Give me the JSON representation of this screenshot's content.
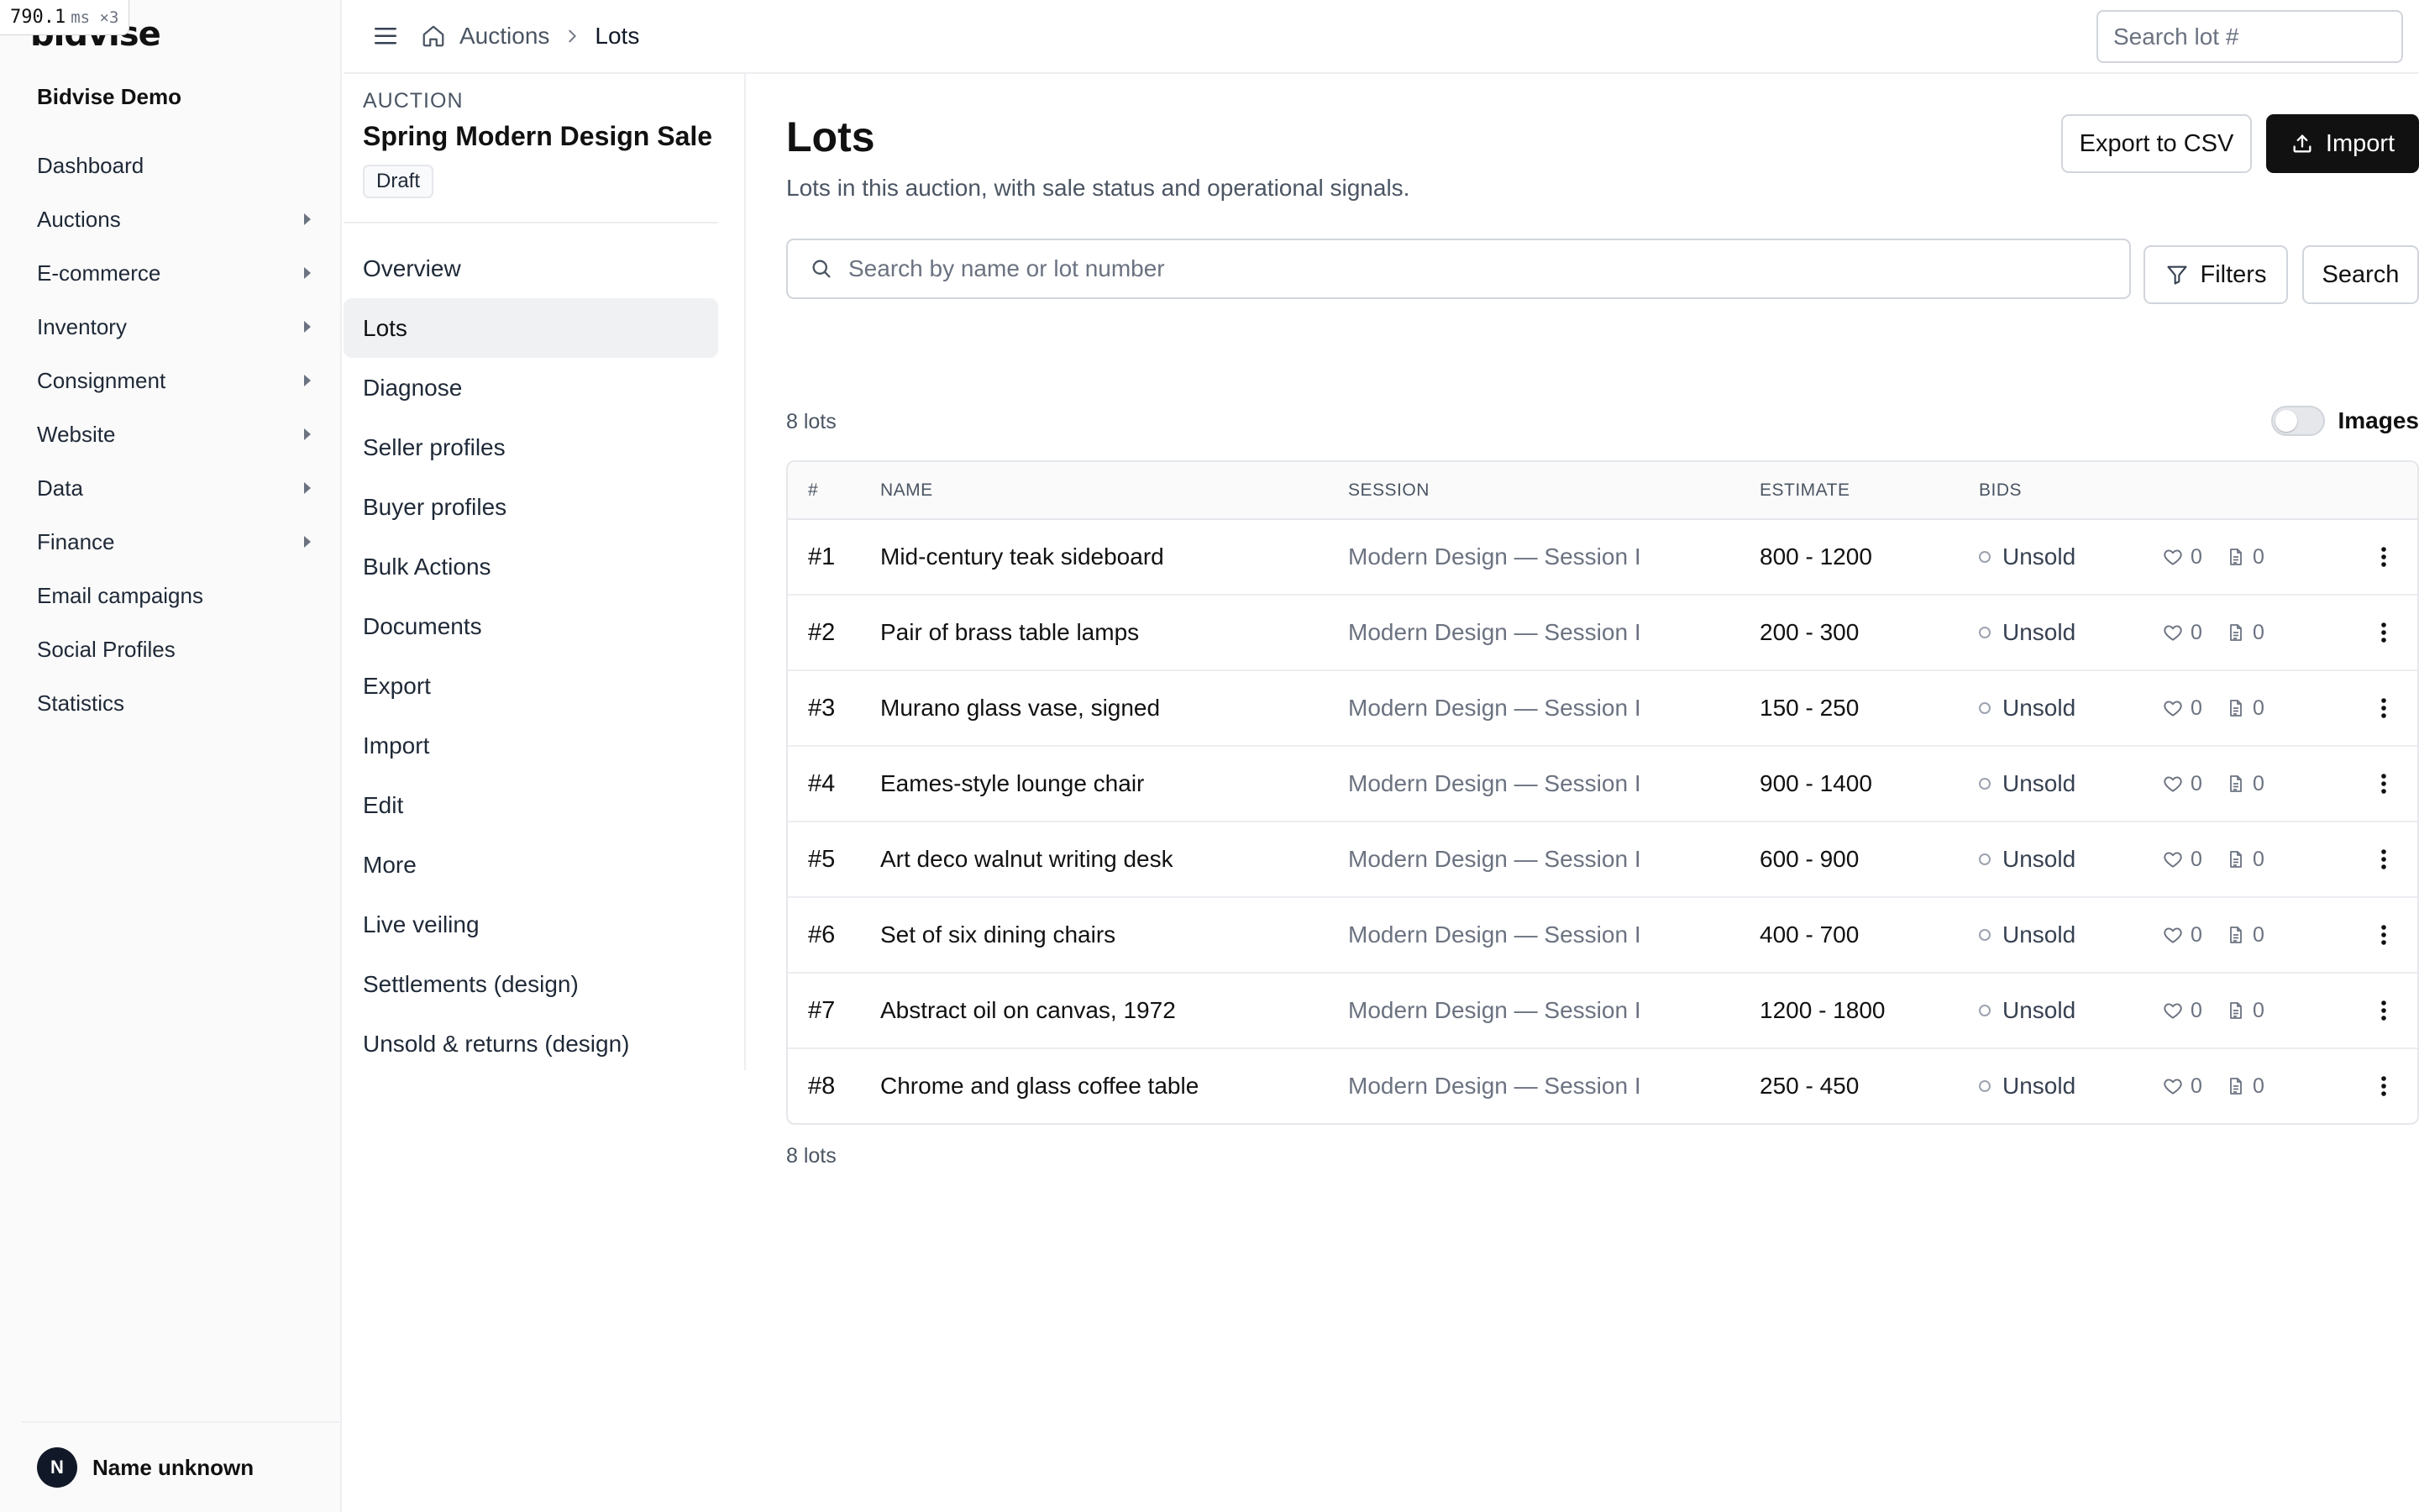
{
  "perf": {
    "value": "790.1",
    "unit": "ms ×3"
  },
  "brand": {
    "logo_text": "bidvise",
    "org_name": "Bidvise Demo"
  },
  "sidebar": {
    "items": [
      {
        "label": "Dashboard",
        "expandable": false
      },
      {
        "label": "Auctions",
        "expandable": true
      },
      {
        "label": "E-commerce",
        "expandable": true
      },
      {
        "label": "Inventory",
        "expandable": true
      },
      {
        "label": "Consignment",
        "expandable": true
      },
      {
        "label": "Website",
        "expandable": true
      },
      {
        "label": "Data",
        "expandable": true
      },
      {
        "label": "Finance",
        "expandable": true
      },
      {
        "label": "Email campaigns",
        "expandable": false
      },
      {
        "label": "Social Profiles",
        "expandable": false
      },
      {
        "label": "Statistics",
        "expandable": false
      }
    ],
    "user": {
      "initial": "N",
      "name": "Name unknown"
    }
  },
  "topbar": {
    "breadcrumb": [
      {
        "label": "Auctions"
      },
      {
        "label": "Lots"
      }
    ],
    "search_placeholder": "Search lot #"
  },
  "auction": {
    "kicker": "AUCTION",
    "title": "Spring Modern Design Sale",
    "status": "Draft",
    "nav": [
      {
        "label": "Overview",
        "active": false
      },
      {
        "label": "Lots",
        "active": true
      },
      {
        "label": "Diagnose",
        "active": false
      },
      {
        "label": "Seller profiles",
        "active": false
      },
      {
        "label": "Buyer profiles",
        "active": false
      },
      {
        "label": "Bulk Actions",
        "active": false
      },
      {
        "label": "Documents",
        "active": false
      },
      {
        "label": "Export",
        "active": false
      },
      {
        "label": "Import",
        "active": false
      },
      {
        "label": "Edit",
        "active": false
      },
      {
        "label": "More",
        "active": false
      },
      {
        "label": "Live veiling",
        "active": false
      },
      {
        "label": "Settlements (design)",
        "active": false
      },
      {
        "label": "Unsold & returns (design)",
        "active": false
      }
    ]
  },
  "main": {
    "title": "Lots",
    "subtitle": "Lots in this auction, with sale status and operational signals.",
    "export_label": "Export to CSV",
    "import_label": "Import",
    "search_placeholder": "Search by name or lot number",
    "filters_label": "Filters",
    "search_label": "Search",
    "count_label": "8 lots",
    "images_label": "Images",
    "images_enabled": false
  },
  "table": {
    "columns": [
      "#",
      "NAME",
      "SESSION",
      "ESTIMATE",
      "BIDS"
    ],
    "rows": [
      {
        "num": "#1",
        "name": "Mid-century teak sideboard",
        "session": "Modern Design — Session I",
        "estimate": "800 - 1200",
        "status": "Unsold",
        "likes": "0",
        "docs": "0"
      },
      {
        "num": "#2",
        "name": "Pair of brass table lamps",
        "session": "Modern Design — Session I",
        "estimate": "200 - 300",
        "status": "Unsold",
        "likes": "0",
        "docs": "0"
      },
      {
        "num": "#3",
        "name": "Murano glass vase, signed",
        "session": "Modern Design — Session I",
        "estimate": "150 - 250",
        "status": "Unsold",
        "likes": "0",
        "docs": "0"
      },
      {
        "num": "#4",
        "name": "Eames-style lounge chair",
        "session": "Modern Design — Session I",
        "estimate": "900 - 1400",
        "status": "Unsold",
        "likes": "0",
        "docs": "0"
      },
      {
        "num": "#5",
        "name": "Art deco walnut writing desk",
        "session": "Modern Design — Session I",
        "estimate": "600 - 900",
        "status": "Unsold",
        "likes": "0",
        "docs": "0"
      },
      {
        "num": "#6",
        "name": "Set of six dining chairs",
        "session": "Modern Design — Session I",
        "estimate": "400 - 700",
        "status": "Unsold",
        "likes": "0",
        "docs": "0"
      },
      {
        "num": "#7",
        "name": "Abstract oil on canvas, 1972",
        "session": "Modern Design — Session I",
        "estimate": "1200 - 1800",
        "status": "Unsold",
        "likes": "0",
        "docs": "0"
      },
      {
        "num": "#8",
        "name": "Chrome and glass coffee table",
        "session": "Modern Design — Session I",
        "estimate": "250 - 450",
        "status": "Unsold",
        "likes": "0",
        "docs": "0"
      }
    ]
  },
  "colors": {
    "primary_button": "#111111",
    "sidebar_bg": "#fafafa",
    "active_nav_bg": "#f0f1f3",
    "border": "#e5e7eb",
    "muted_text": "#6b7280"
  },
  "icons": {
    "menu": "hamburger-icon",
    "home": "home-icon",
    "breadcrumb_separator": "chevron-right-icon",
    "search": "search-icon",
    "import": "upload-icon",
    "filter": "filter-icon",
    "status": "circle-outline-icon",
    "likes": "heart-icon",
    "docs": "document-icon",
    "row_actions": "more-vertical-icon",
    "expand": "caret-right-icon"
  }
}
